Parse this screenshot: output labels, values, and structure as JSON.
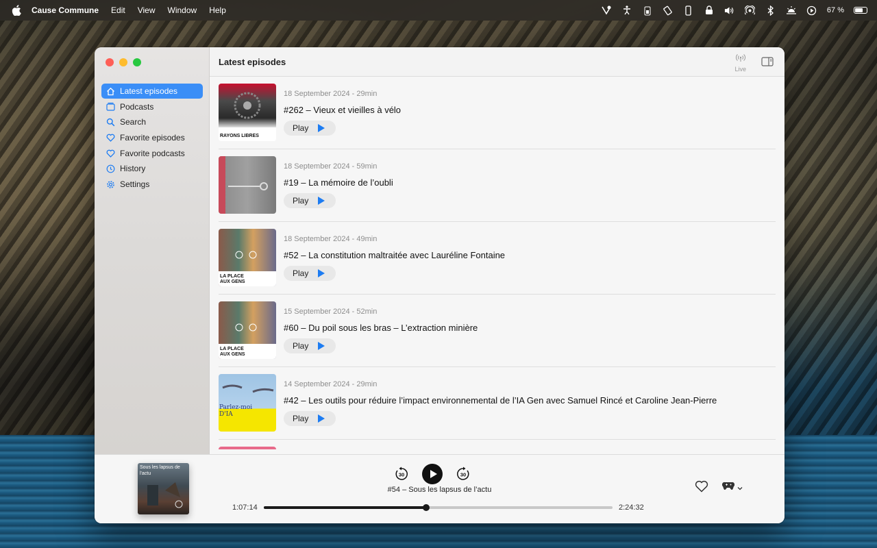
{
  "menubar": {
    "app_name": "Cause Commune",
    "menus": [
      "Edit",
      "View",
      "Window",
      "Help"
    ],
    "battery_text": "67 %",
    "battery_level": 0.67,
    "status_icons": [
      "tool-icon",
      "accessibility-icon",
      "battery-status-icon",
      "screen-rotate-icon",
      "phone-icon",
      "lock-icon",
      "volume-icon",
      "airplay-audio-icon",
      "bluetooth-icon",
      "weather-icon",
      "play-circle-icon"
    ]
  },
  "sidebar": {
    "items": [
      {
        "label": "Latest episodes",
        "icon": "home-icon",
        "active": true
      },
      {
        "label": "Podcasts",
        "icon": "podcasts-icon",
        "active": false
      },
      {
        "label": "Search",
        "icon": "search-icon",
        "active": false
      },
      {
        "label": "Favorite episodes",
        "icon": "heart-icon",
        "active": false
      },
      {
        "label": "Favorite podcasts",
        "icon": "heart-icon",
        "active": false
      },
      {
        "label": "History",
        "icon": "clock-icon",
        "active": false
      },
      {
        "label": "Settings",
        "icon": "gear-icon",
        "active": false
      }
    ]
  },
  "toolbar": {
    "title": "Latest episodes",
    "live_label": "Live"
  },
  "episodes": [
    {
      "meta": "18 September 2024 - 29min",
      "title": "#262 – Vieux et vieilles à vélo",
      "play_label": "Play",
      "art_caption": "RAYONS LIBRES"
    },
    {
      "meta": "18 September 2024 - 59min",
      "title": "#19 – La mémoire de l’oubli",
      "play_label": "Play",
      "art_caption": ""
    },
    {
      "meta": "18 September 2024 - 49min",
      "title": "#52 – La constitution maltraitée avec Lauréline Fontaine",
      "play_label": "Play",
      "art_caption": "LA PLACE AUX GENS"
    },
    {
      "meta": "15 September 2024 - 52min",
      "title": "#60 – Du poil sous les bras – L’extraction minière",
      "play_label": "Play",
      "art_caption": "LA PLACE AUX GENS"
    },
    {
      "meta": "14 September 2024 - 29min",
      "title": "#42 – Les outils pour réduire l’impact environnemental de l’IA Gen avec Samuel Rincé et Caroline Jean-Pierre",
      "play_label": "Play",
      "art_caption": "Parlez-moi D'IA"
    }
  ],
  "player": {
    "now_playing_title": "#54 – Sous les lapsus de l’actu",
    "art_text": "Sous les lapsus de l'actu",
    "elapsed": "1:07:14",
    "total": "2:24:32",
    "progress": 0.465,
    "skip_back_label": "30",
    "skip_forward_label": "30"
  }
}
